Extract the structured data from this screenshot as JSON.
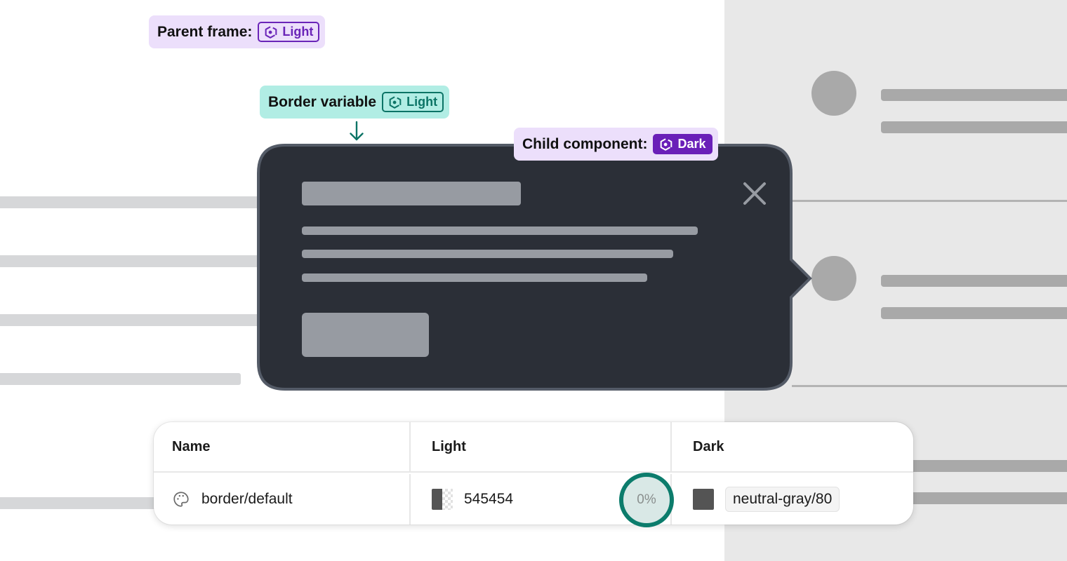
{
  "annotations": {
    "parent_frame": {
      "label": "Parent frame:",
      "mode": "Light",
      "icon": "variable-mode-icon"
    },
    "border_variable": {
      "label": "Border variable",
      "mode": "Light",
      "icon": "variable-mode-icon",
      "arrow": "arrow-down-icon"
    },
    "child_component": {
      "label": "Child component:",
      "mode": "Dark",
      "icon": "variable-mode-icon"
    }
  },
  "popover": {
    "theme": "Dark",
    "background": "#2b2f37",
    "border_color": "#545b67",
    "close_icon": "close-icon"
  },
  "table": {
    "columns": [
      "Name",
      "Light",
      "Dark"
    ],
    "rows": [
      {
        "name": "border/default",
        "name_icon": "palette-icon",
        "light": {
          "value": "545454",
          "swatch": "#545454",
          "opacity": "0%"
        },
        "dark": {
          "alias": "neutral-gray/80",
          "swatch": "#545454"
        }
      }
    ]
  },
  "colors": {
    "purple_accent": "#6a1fb8",
    "purple_tag_bg": "#ecdffb",
    "teal_accent": "#0c7466",
    "teal_tag_bg": "#b1ede4",
    "right_panel_bg": "#e8e8e8",
    "skeleton": "#979ba2"
  }
}
